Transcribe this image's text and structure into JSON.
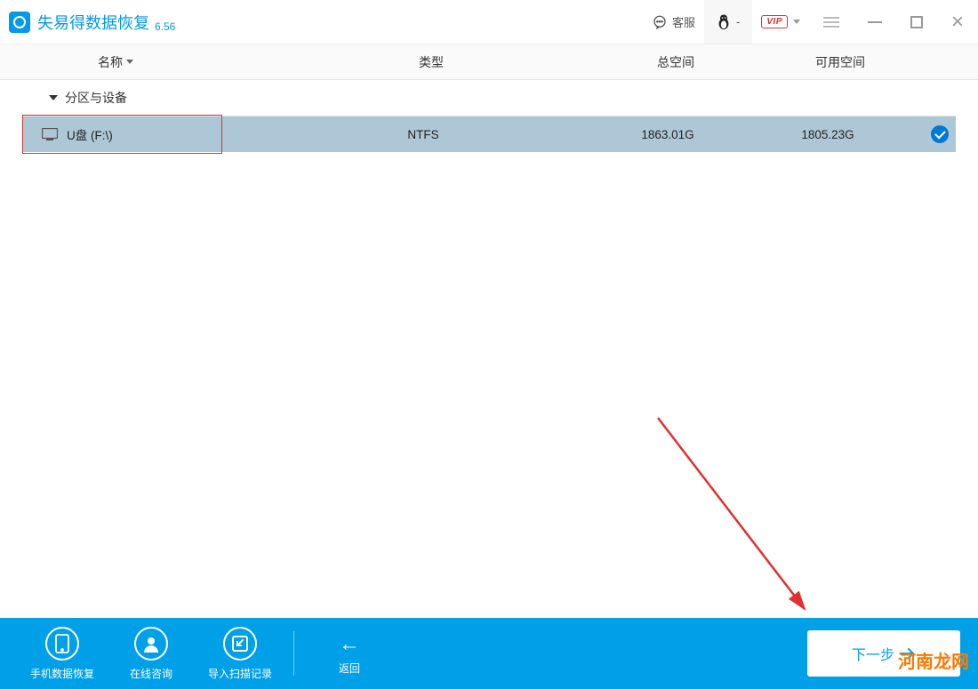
{
  "titlebar": {
    "app_name": "失易得数据恢复",
    "version": "6.56",
    "customer_service": "客服",
    "profile_text": "-",
    "vip_label": "VIP"
  },
  "table": {
    "columns": {
      "name": "名称",
      "type": "类型",
      "total": "总空间",
      "free": "可用空间"
    },
    "section_header": "分区与设备",
    "rows": [
      {
        "name": "U盘 (F:\\)",
        "type": "NTFS",
        "total": "1863.01G",
        "free": "1805.23G",
        "selected": true
      }
    ]
  },
  "footer": {
    "phone_recovery": "手机数据恢复",
    "online_consult": "在线咨询",
    "import_scan": "导入扫描记录",
    "back": "返回",
    "next": "下一步"
  },
  "watermark": "河南龙网"
}
